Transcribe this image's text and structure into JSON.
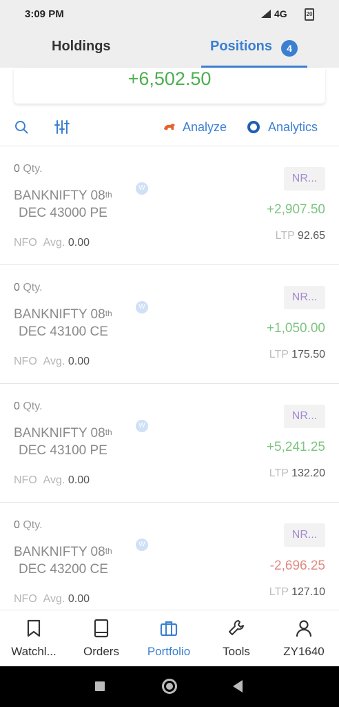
{
  "status_bar": {
    "time": "3:09 PM",
    "network": "4G",
    "battery": "20"
  },
  "tabs": [
    {
      "label": "Holdings",
      "active": false
    },
    {
      "label": "Positions",
      "active": true,
      "badge": "4"
    }
  ],
  "summary": {
    "total_pnl": "+6,502.50"
  },
  "toolbar": {
    "analyze_label": "Analyze",
    "analytics_label": "Analytics"
  },
  "positions": [
    {
      "qty": "0",
      "qty_label": "Qty.",
      "symbol_line1": "BANKNIFTY 08",
      "symbol_sup": "th",
      "symbol_line2": "DEC 43000 PE",
      "exchange": "NFO",
      "avg_label": "Avg.",
      "avg": "0.00",
      "product": "NR...",
      "pnl": "+2,907.50",
      "ltp_label": "LTP",
      "ltp": "92.65",
      "badge": "W"
    },
    {
      "qty": "0",
      "qty_label": "Qty.",
      "symbol_line1": "BANKNIFTY 08",
      "symbol_sup": "th",
      "symbol_line2": "DEC 43100 CE",
      "exchange": "NFO",
      "avg_label": "Avg.",
      "avg": "0.00",
      "product": "NR...",
      "pnl": "+1,050.00",
      "ltp_label": "LTP",
      "ltp": "175.50",
      "badge": "W"
    },
    {
      "qty": "0",
      "qty_label": "Qty.",
      "symbol_line1": "BANKNIFTY 08",
      "symbol_sup": "th",
      "symbol_line2": "DEC 43100 PE",
      "exchange": "NFO",
      "avg_label": "Avg.",
      "avg": "0.00",
      "product": "NR...",
      "pnl": "+5,241.25",
      "ltp_label": "LTP",
      "ltp": "132.20",
      "badge": "W"
    },
    {
      "qty": "0",
      "qty_label": "Qty.",
      "symbol_line1": "BANKNIFTY 08",
      "symbol_sup": "th",
      "symbol_line2": "DEC 43200 CE",
      "exchange": "NFO",
      "avg_label": "Avg.",
      "avg": "0.00",
      "product": "NR...",
      "pnl": "-2,696.25",
      "ltp_label": "LTP",
      "ltp": "127.10",
      "badge": "W"
    }
  ],
  "bottom_nav": [
    {
      "label": "Watchl...",
      "icon": "bookmark-icon",
      "active": false
    },
    {
      "label": "Orders",
      "icon": "book-icon",
      "active": false
    },
    {
      "label": "Portfolio",
      "icon": "briefcase-icon",
      "active": true
    },
    {
      "label": "Tools",
      "icon": "wrench-icon",
      "active": false
    },
    {
      "label": "ZY1640",
      "icon": "user-icon",
      "active": false
    }
  ],
  "colors": {
    "accent": "#3b7fd1",
    "profit": "#4caf50",
    "loss": "#e08a82"
  }
}
